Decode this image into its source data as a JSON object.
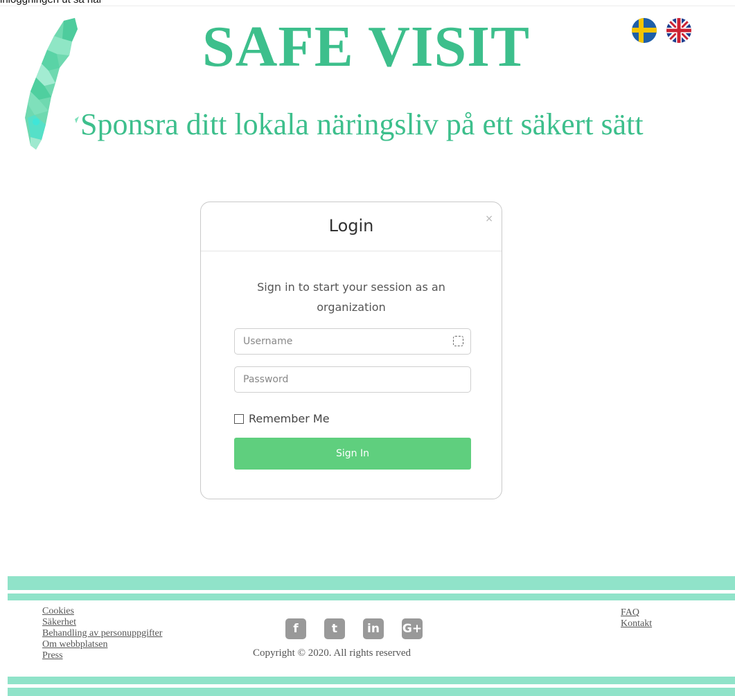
{
  "top_cut_text": "inloggningen ut så här",
  "header": {
    "title": "SAFE VISIT",
    "tagline": "Sponsra ditt lokala näringsliv på ett säkert sätt",
    "brand_color": "#3dbf8c",
    "languages": [
      {
        "name": "swedish-flag-icon"
      },
      {
        "name": "uk-flag-icon"
      }
    ]
  },
  "login": {
    "title": "Login",
    "close": "×",
    "message": "Sign in to start your session as an organization",
    "username_placeholder": "Username",
    "password_placeholder": "Password",
    "remember_label": "Remember Me",
    "signin_label": "Sign In",
    "button_color": "#5fcf7e"
  },
  "footer": {
    "links_left": [
      "Cookies",
      "Säkerhet",
      "Behandling av personuppgifter",
      "Om webbplatsen",
      "Press"
    ],
    "links_right": [
      "FAQ",
      "Kontakt"
    ],
    "social": [
      {
        "icon": "facebook-icon",
        "glyph": "f"
      },
      {
        "icon": "twitter-icon",
        "glyph": "t"
      },
      {
        "icon": "linkedin-icon",
        "glyph": "in"
      },
      {
        "icon": "google-plus-icon",
        "glyph": "G+"
      }
    ],
    "copyright": "Copyright © 2020. All rights reserved",
    "band_color": "#90e3c9"
  }
}
